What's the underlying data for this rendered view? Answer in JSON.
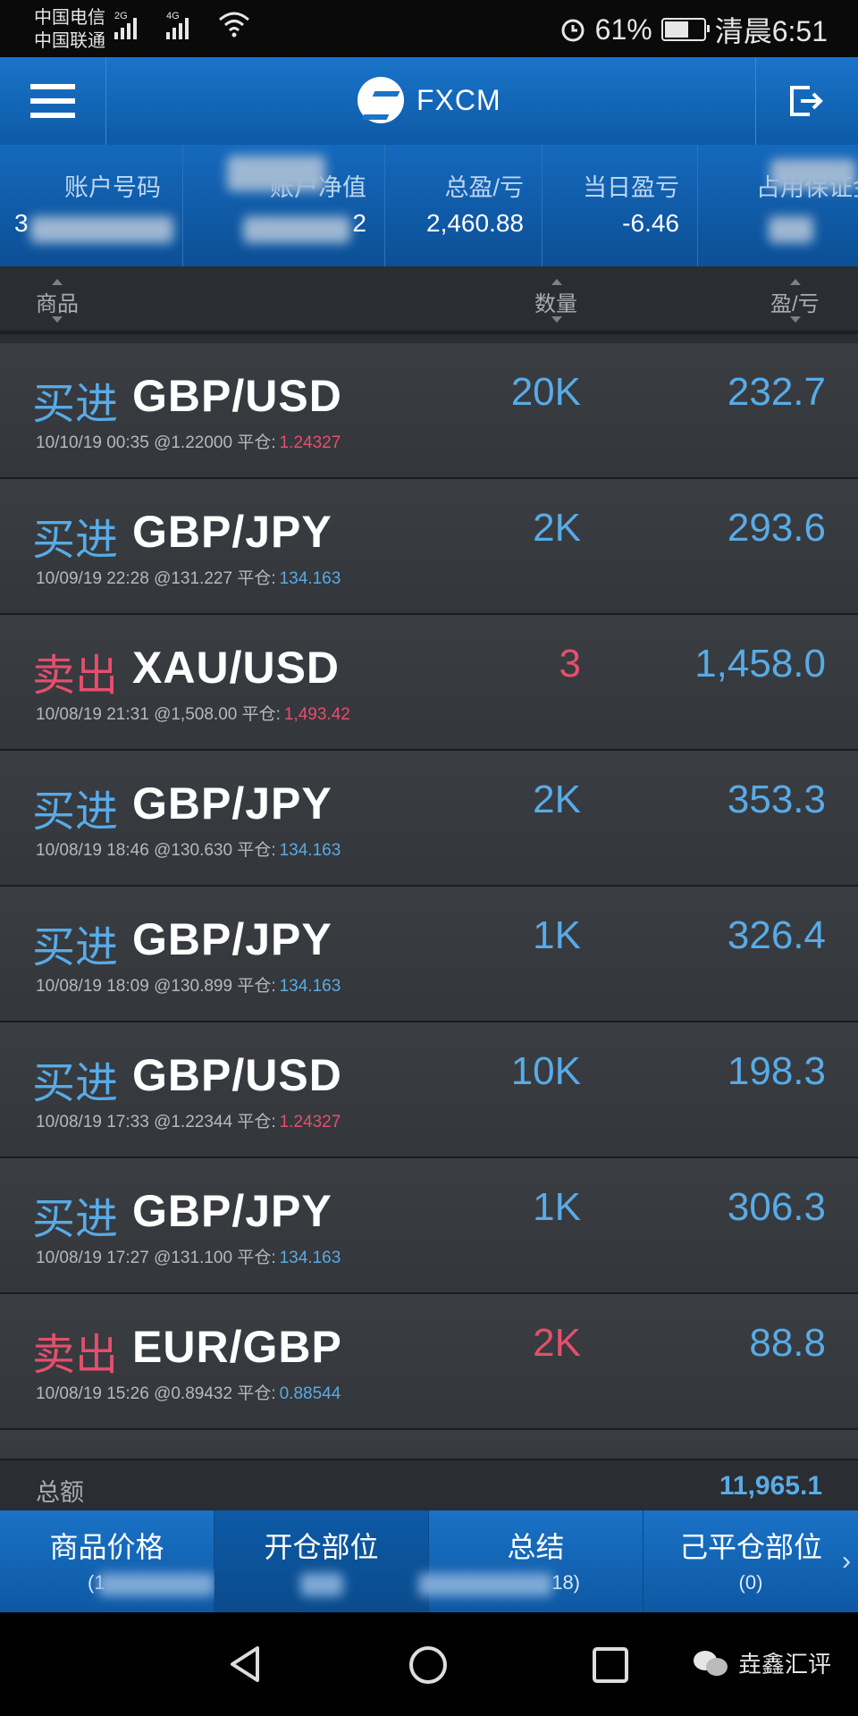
{
  "status_bar": {
    "carrier1": "中国电信",
    "carrier2": "中国联通",
    "net1": "2G",
    "net2": "4G",
    "battery": "61%",
    "time": "清晨6:51"
  },
  "app": {
    "title": "FXCM"
  },
  "summary": {
    "col1_label": "账户号码",
    "col1_value": "3",
    "col2_label": "账户净值",
    "col2_value": "2",
    "col3_label": "总盈/亏",
    "col3_value": "2,460.88",
    "col4_label": "当日盈亏",
    "col4_value": "-6.46",
    "col5_label": "占用保证金",
    "col5_value": ""
  },
  "columns": {
    "product": "商品",
    "quantity": "数量",
    "pl": "盈/亏"
  },
  "rows": [
    {
      "side": "买进",
      "side_type": "buy",
      "symbol": "GBP/USD",
      "datetime": "10/10/19 00:35",
      "open": "@1.22000",
      "close_label": "平仓:",
      "close": "1.24327",
      "close_color": "#e44f6c",
      "qty": "20K",
      "qty_type": "buy",
      "pl": "232.7"
    },
    {
      "side": "买进",
      "side_type": "buy",
      "symbol": "GBP/JPY",
      "datetime": "10/09/19 22:28",
      "open": "@131.227",
      "close_label": "平仓:",
      "close": "134.163",
      "close_color": "#58abe6",
      "qty": "2K",
      "qty_type": "buy",
      "pl": "293.6"
    },
    {
      "side": "卖出",
      "side_type": "sell",
      "symbol": "XAU/USD",
      "datetime": "10/08/19 21:31",
      "open": "@1,508.00",
      "close_label": "平仓:",
      "close": "1,493.42",
      "close_color": "#e44f6c",
      "qty": "3",
      "qty_type": "sell",
      "pl": "1,458.0"
    },
    {
      "side": "买进",
      "side_type": "buy",
      "symbol": "GBP/JPY",
      "datetime": "10/08/19 18:46",
      "open": "@130.630",
      "close_label": "平仓:",
      "close": "134.163",
      "close_color": "#58abe6",
      "qty": "2K",
      "qty_type": "buy",
      "pl": "353.3"
    },
    {
      "side": "买进",
      "side_type": "buy",
      "symbol": "GBP/JPY",
      "datetime": "10/08/19 18:09",
      "open": "@130.899",
      "close_label": "平仓:",
      "close": "134.163",
      "close_color": "#58abe6",
      "qty": "1K",
      "qty_type": "buy",
      "pl": "326.4"
    },
    {
      "side": "买进",
      "side_type": "buy",
      "symbol": "GBP/USD",
      "datetime": "10/08/19 17:33",
      "open": "@1.22344",
      "close_label": "平仓:",
      "close": "1.24327",
      "close_color": "#e44f6c",
      "qty": "10K",
      "qty_type": "buy",
      "pl": "198.3"
    },
    {
      "side": "买进",
      "side_type": "buy",
      "symbol": "GBP/JPY",
      "datetime": "10/08/19 17:27",
      "open": "@131.100",
      "close_label": "平仓:",
      "close": "134.163",
      "close_color": "#58abe6",
      "qty": "1K",
      "qty_type": "buy",
      "pl": "306.3"
    },
    {
      "side": "卖出",
      "side_type": "sell",
      "symbol": "EUR/GBP",
      "datetime": "10/08/19 15:26",
      "open": "@0.89432",
      "close_label": "平仓:",
      "close": "0.88544",
      "close_color": "#58abe6",
      "qty": "2K",
      "qty_type": "sell",
      "pl": "88.8"
    }
  ],
  "total": {
    "label": "总额",
    "value": "11,965.1"
  },
  "tabs": [
    {
      "label": "商品价格",
      "count": "(1"
    },
    {
      "label": "开仓部位",
      "count": ""
    },
    {
      "label": "总结",
      "count": "18)"
    },
    {
      "label": "己平仓部位",
      "count": "(0)"
    }
  ],
  "watermark": "垚鑫汇评",
  "colors": {
    "buy": "#58abe6",
    "sell": "#e44f6c",
    "header_blue": "#1a74c9"
  }
}
